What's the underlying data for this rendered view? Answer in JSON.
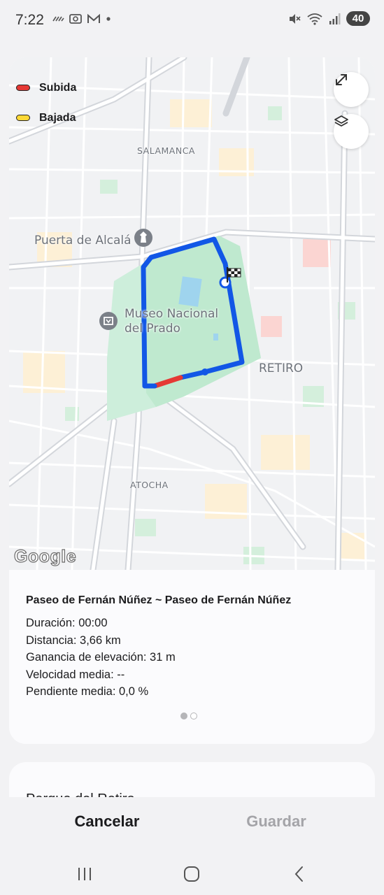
{
  "status_bar": {
    "time": "7:22",
    "battery": "40",
    "icons": [
      "wind-icon",
      "screenshot-icon",
      "gmail-icon",
      "dot-icon",
      "mute-icon",
      "wifi-icon",
      "signal-icon"
    ]
  },
  "map": {
    "legend": [
      {
        "label": "Subida",
        "color": "#e53935"
      },
      {
        "label": "Bajada",
        "color": "#fdd835"
      }
    ],
    "labels": {
      "salamanca": "SALAMANCA",
      "puerta": "Puerta de Alcalá",
      "museo_line1": "Museo Nacional",
      "museo_line2": "del Prado",
      "retiro": "RETIRO",
      "atocha": "ATOCHA"
    },
    "google_logo": "Google",
    "route_color": "#1257e6",
    "park_color": "#c6efd7"
  },
  "info": {
    "title": "Paseo de Fernán Núñez ~ Paseo de Fernán Núñez",
    "duration": "Duración: 00:00",
    "distance": "Distancia: 3,66 km",
    "elevation": "Ganancia de elevación: 31 m",
    "speed": "Velocidad media: --",
    "slope": "Pendiente media: 0,0 %"
  },
  "second_card": {
    "title": "Parque del Retiro"
  },
  "actions": {
    "cancel": "Cancelar",
    "save": "Guardar"
  }
}
